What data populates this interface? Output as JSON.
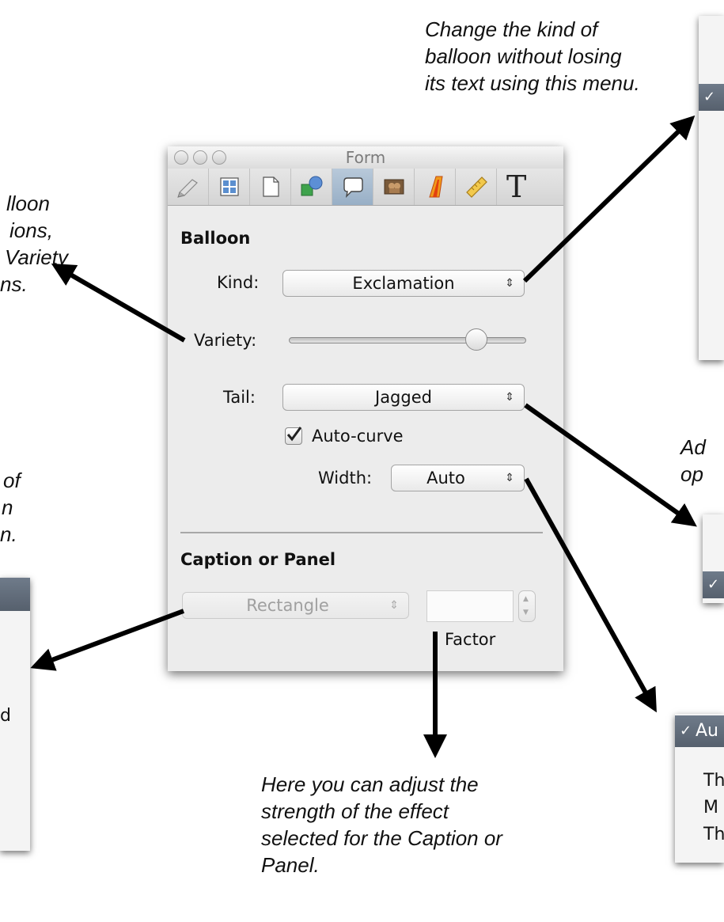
{
  "annotations": {
    "kind_menu": [
      "Change the kind of",
      "balloon without losing",
      "its text using this menu."
    ],
    "variety": [
      "lloon",
      "ions,",
      "Variety",
      "ns."
    ],
    "caption": [
      "of",
      "n",
      "n."
    ],
    "tail": [
      "Ad",
      "op"
    ],
    "factor": [
      "Here you can adjust the",
      "strength of the effect",
      "selected for the Caption or",
      "Panel."
    ]
  },
  "window": {
    "title": "Form",
    "toolbar_icons": [
      "pen-icon",
      "grid-icon",
      "page-icon",
      "shapes-icon",
      "balloon-icon",
      "photo-icon",
      "text-effect-icon",
      "ruler-icon",
      "text-icon"
    ],
    "toolbar_text_glyph": "T"
  },
  "balloon": {
    "section_title": "Balloon",
    "kind_label": "Kind:",
    "kind_value": "Exclamation",
    "variety_label": "Variety:",
    "variety_level": 0.82,
    "tail_label": "Tail:",
    "tail_value": "Jagged",
    "autocurve_label": "Auto-curve",
    "autocurve_checked": true,
    "width_label": "Width:",
    "width_value": "Auto"
  },
  "caption": {
    "section_title": "Caption or Panel",
    "shape_value": "Rectangle",
    "factor_value": "",
    "factor_label": "Factor"
  },
  "menus": {
    "kind_check": "✓",
    "caption_item": "d",
    "tail_check": "✓",
    "width_items": [
      "Au",
      "Th",
      "M",
      "Th"
    ],
    "width_check": "✓"
  },
  "colors": {
    "panel_bg": "#ececec",
    "selection": "#5f6a77",
    "active_tab": "#a6bbd0"
  }
}
